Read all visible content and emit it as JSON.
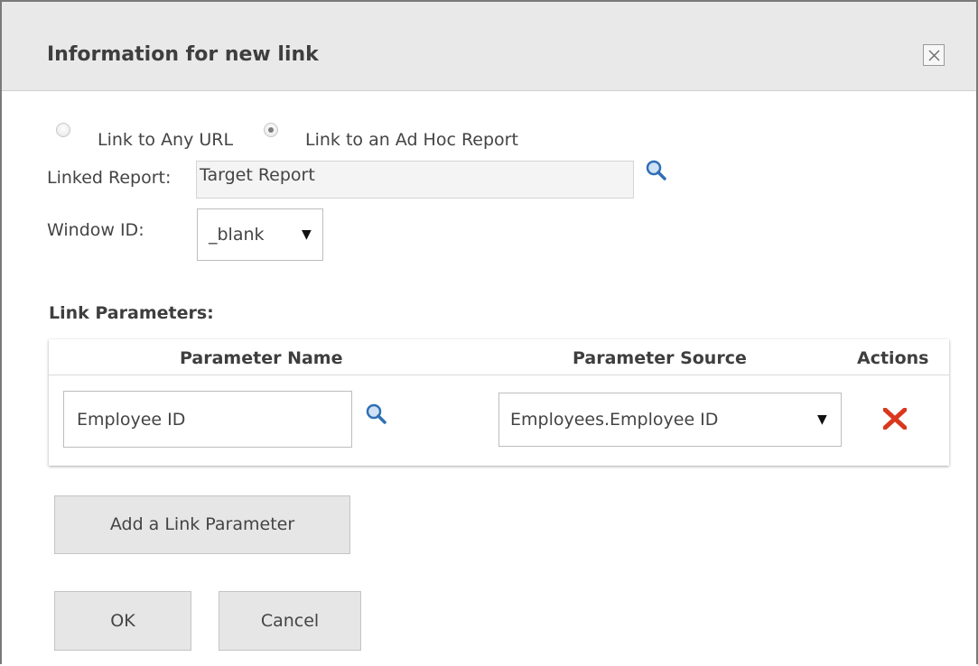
{
  "dialog": {
    "title": "Information for new link"
  },
  "link_type": {
    "options": [
      {
        "label": "Link to Any URL",
        "checked": false
      },
      {
        "label": "Link to an Ad Hoc Report",
        "checked": true
      }
    ]
  },
  "linked_report": {
    "label": "Linked Report:",
    "value": "Target Report"
  },
  "window_id": {
    "label": "Window ID:",
    "value": "_blank"
  },
  "link_parameters": {
    "heading": "Link Parameters:",
    "columns": [
      "Parameter Name",
      "Parameter Source",
      "Actions"
    ],
    "rows": [
      {
        "name": "Employee ID",
        "source": "Employees.Employee ID"
      }
    ]
  },
  "buttons": {
    "add_parameter": "Add a Link Parameter",
    "ok": "OK",
    "cancel": "Cancel"
  },
  "icons": {
    "close": "close-icon",
    "search": "search-icon",
    "dropdown": "dropdown-arrow-icon",
    "delete": "delete-icon"
  },
  "colors": {
    "delete_icon": "#d9381e",
    "search_icon": "#2f6fb5",
    "titlebar": "#e9e9e9",
    "button": "#e6e6e6"
  }
}
